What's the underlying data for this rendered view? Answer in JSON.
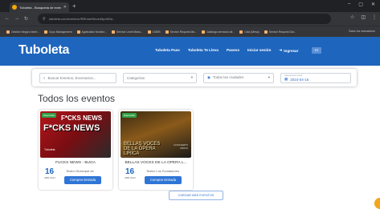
{
  "browser": {
    "tab_title": "Tuboleta - Busqueda de even",
    "url": "tuboleta.com/eventos?BRnmeNhoed3pd4Da...",
    "bookmarks": [
      "Gestión Seguro Ident...",
      "Cuyo Management",
      "Application Monitor...",
      "Service Level Mana...",
      "CMDB",
      "Service Request Ma...",
      "Catálogo servicios de...",
      "Cola (Mesa)",
      "Service Request Dat..."
    ],
    "bookmarks_right": "Todos los marcadores"
  },
  "header": {
    "logo": "Tuboleta",
    "menu": [
      "Tuboleta Pass",
      "Tuboleta Te Lleva",
      "Paseos",
      "Iniciar sesión"
    ],
    "ingresar": "Ingresar",
    "lang": "ES"
  },
  "search": {
    "events_placeholder": "Buscar Eventos, Escenarios...",
    "category": "Categorías",
    "city": "Todas las ciudades",
    "date_label": "Seleccionar fecha",
    "date_value": "2024-04-16"
  },
  "section_title": "Todos los eventos",
  "events": [
    {
      "badge": "Disponible",
      "poster_top": "F*CKS NEWS",
      "poster_big": "F*CKS NEWS",
      "poster_small": "Tuboleta",
      "name": "FUCKS NEWS - BUGA",
      "day": "16",
      "month": "ABR 2024",
      "venue": "Teatro Municipal de",
      "button": "Comprar Entrada"
    },
    {
      "badge": "Disponible",
      "poster_big": "BELLAS VOCES DE LA ÓPERA LIRICA",
      "poster_side": "CONCIERTO LÍRICO",
      "name": "BELLAS VOCES DE LA OPERA L...",
      "day": "16",
      "month": "ABR 2024",
      "venue": "Teatro Los Fundadores",
      "button": "Comprar Entrada"
    }
  ],
  "load_more": "CARGAR MÁS EVENTOS",
  "colors": {
    "header": "#1e65bd",
    "button": "#2f75d6",
    "fab": "#f4a51c"
  }
}
